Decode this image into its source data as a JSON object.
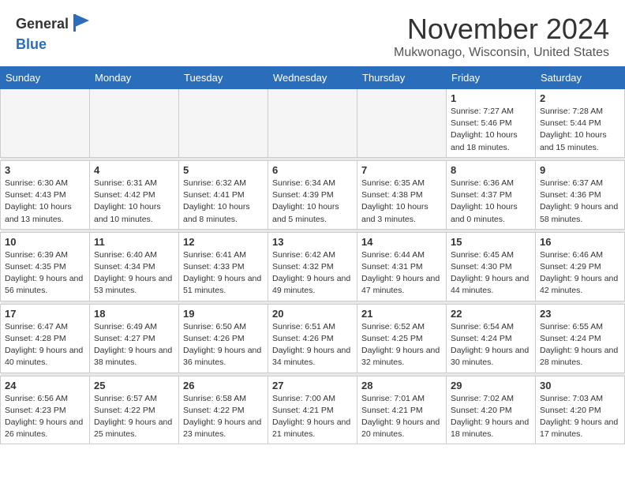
{
  "header": {
    "logo_line1": "General",
    "logo_line2": "Blue",
    "month_title": "November 2024",
    "location": "Mukwonago, Wisconsin, United States"
  },
  "days_of_week": [
    "Sunday",
    "Monday",
    "Tuesday",
    "Wednesday",
    "Thursday",
    "Friday",
    "Saturday"
  ],
  "weeks": [
    [
      {
        "day": "",
        "info": ""
      },
      {
        "day": "",
        "info": ""
      },
      {
        "day": "",
        "info": ""
      },
      {
        "day": "",
        "info": ""
      },
      {
        "day": "",
        "info": ""
      },
      {
        "day": "1",
        "info": "Sunrise: 7:27 AM\nSunset: 5:46 PM\nDaylight: 10 hours and 18 minutes."
      },
      {
        "day": "2",
        "info": "Sunrise: 7:28 AM\nSunset: 5:44 PM\nDaylight: 10 hours and 15 minutes."
      }
    ],
    [
      {
        "day": "3",
        "info": "Sunrise: 6:30 AM\nSunset: 4:43 PM\nDaylight: 10 hours and 13 minutes."
      },
      {
        "day": "4",
        "info": "Sunrise: 6:31 AM\nSunset: 4:42 PM\nDaylight: 10 hours and 10 minutes."
      },
      {
        "day": "5",
        "info": "Sunrise: 6:32 AM\nSunset: 4:41 PM\nDaylight: 10 hours and 8 minutes."
      },
      {
        "day": "6",
        "info": "Sunrise: 6:34 AM\nSunset: 4:39 PM\nDaylight: 10 hours and 5 minutes."
      },
      {
        "day": "7",
        "info": "Sunrise: 6:35 AM\nSunset: 4:38 PM\nDaylight: 10 hours and 3 minutes."
      },
      {
        "day": "8",
        "info": "Sunrise: 6:36 AM\nSunset: 4:37 PM\nDaylight: 10 hours and 0 minutes."
      },
      {
        "day": "9",
        "info": "Sunrise: 6:37 AM\nSunset: 4:36 PM\nDaylight: 9 hours and 58 minutes."
      }
    ],
    [
      {
        "day": "10",
        "info": "Sunrise: 6:39 AM\nSunset: 4:35 PM\nDaylight: 9 hours and 56 minutes."
      },
      {
        "day": "11",
        "info": "Sunrise: 6:40 AM\nSunset: 4:34 PM\nDaylight: 9 hours and 53 minutes."
      },
      {
        "day": "12",
        "info": "Sunrise: 6:41 AM\nSunset: 4:33 PM\nDaylight: 9 hours and 51 minutes."
      },
      {
        "day": "13",
        "info": "Sunrise: 6:42 AM\nSunset: 4:32 PM\nDaylight: 9 hours and 49 minutes."
      },
      {
        "day": "14",
        "info": "Sunrise: 6:44 AM\nSunset: 4:31 PM\nDaylight: 9 hours and 47 minutes."
      },
      {
        "day": "15",
        "info": "Sunrise: 6:45 AM\nSunset: 4:30 PM\nDaylight: 9 hours and 44 minutes."
      },
      {
        "day": "16",
        "info": "Sunrise: 6:46 AM\nSunset: 4:29 PM\nDaylight: 9 hours and 42 minutes."
      }
    ],
    [
      {
        "day": "17",
        "info": "Sunrise: 6:47 AM\nSunset: 4:28 PM\nDaylight: 9 hours and 40 minutes."
      },
      {
        "day": "18",
        "info": "Sunrise: 6:49 AM\nSunset: 4:27 PM\nDaylight: 9 hours and 38 minutes."
      },
      {
        "day": "19",
        "info": "Sunrise: 6:50 AM\nSunset: 4:26 PM\nDaylight: 9 hours and 36 minutes."
      },
      {
        "day": "20",
        "info": "Sunrise: 6:51 AM\nSunset: 4:26 PM\nDaylight: 9 hours and 34 minutes."
      },
      {
        "day": "21",
        "info": "Sunrise: 6:52 AM\nSunset: 4:25 PM\nDaylight: 9 hours and 32 minutes."
      },
      {
        "day": "22",
        "info": "Sunrise: 6:54 AM\nSunset: 4:24 PM\nDaylight: 9 hours and 30 minutes."
      },
      {
        "day": "23",
        "info": "Sunrise: 6:55 AM\nSunset: 4:24 PM\nDaylight: 9 hours and 28 minutes."
      }
    ],
    [
      {
        "day": "24",
        "info": "Sunrise: 6:56 AM\nSunset: 4:23 PM\nDaylight: 9 hours and 26 minutes."
      },
      {
        "day": "25",
        "info": "Sunrise: 6:57 AM\nSunset: 4:22 PM\nDaylight: 9 hours and 25 minutes."
      },
      {
        "day": "26",
        "info": "Sunrise: 6:58 AM\nSunset: 4:22 PM\nDaylight: 9 hours and 23 minutes."
      },
      {
        "day": "27",
        "info": "Sunrise: 7:00 AM\nSunset: 4:21 PM\nDaylight: 9 hours and 21 minutes."
      },
      {
        "day": "28",
        "info": "Sunrise: 7:01 AM\nSunset: 4:21 PM\nDaylight: 9 hours and 20 minutes."
      },
      {
        "day": "29",
        "info": "Sunrise: 7:02 AM\nSunset: 4:20 PM\nDaylight: 9 hours and 18 minutes."
      },
      {
        "day": "30",
        "info": "Sunrise: 7:03 AM\nSunset: 4:20 PM\nDaylight: 9 hours and 17 minutes."
      }
    ]
  ]
}
